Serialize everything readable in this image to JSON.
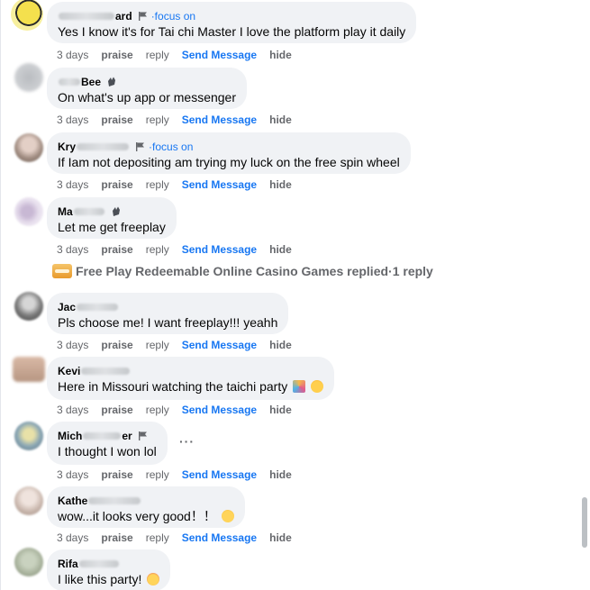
{
  "comments": [
    {
      "name_prefix": "",
      "name_suffix": "ard",
      "badge": "flag-icon",
      "focus": "·focus on",
      "text": "Yes I know it's for Tai chi Master I love the platform play it daily",
      "time": "3 days",
      "praise": "praise",
      "reply": "reply",
      "send": "Send Message",
      "hide": "hide"
    },
    {
      "name_prefix": "",
      "name_suffix": "Bee",
      "badge": "clap-icon",
      "focus": "",
      "text": "On what's up app or messenger",
      "time": "3 days",
      "praise": "praise",
      "reply": "reply",
      "send": "Send Message",
      "hide": "hide"
    },
    {
      "name_prefix": "Kry",
      "name_suffix": "",
      "badge": "flag-icon",
      "focus": "·focus on",
      "text": "If Iam not depositing am trying my luck on the free spin wheel",
      "time": "3 days",
      "praise": "praise",
      "reply": "reply",
      "send": "Send Message",
      "hide": "hide"
    },
    {
      "name_prefix": "Ma",
      "name_suffix": "",
      "badge": "clap-icon",
      "focus": "",
      "text": "Let me get freeplay",
      "time": "3 days",
      "praise": "praise",
      "reply": "reply",
      "send": "Send Message",
      "hide": "hide"
    },
    {
      "name_prefix": "Jac",
      "name_suffix": "",
      "badge": "",
      "focus": "",
      "text": "Pls choose me! I want freeplay!!! yeahh",
      "time": "3 days",
      "praise": "praise",
      "reply": "reply",
      "send": "Send Message",
      "hide": "hide"
    },
    {
      "name_prefix": "Kevi",
      "name_suffix": "",
      "badge": "",
      "focus": "",
      "text": "Here in Missouri watching the taichi party",
      "time": "3 days",
      "praise": "praise",
      "reply": "reply",
      "send": "Send Message",
      "hide": "hide"
    },
    {
      "name_prefix": "Mich",
      "name_suffix": "er",
      "badge": "flag-icon",
      "focus": "",
      "text": "I thought I won lol",
      "time": "3 days",
      "praise": "praise",
      "reply": "reply",
      "send": "Send Message",
      "hide": "hide"
    },
    {
      "name_prefix": "Kathe",
      "name_suffix": "",
      "badge": "",
      "focus": "",
      "text": "wow...it looks very good！！",
      "time": "3 days",
      "praise": "praise",
      "reply": "reply",
      "send": "Send Message",
      "hide": "hide"
    },
    {
      "name_prefix": "Rifa",
      "name_suffix": "",
      "badge": "",
      "focus": "",
      "text": "I like this party!",
      "time": "",
      "praise": "",
      "reply": "",
      "send": "",
      "hide": ""
    }
  ],
  "reply_summary": {
    "page_name": "Free Play Redeemable Online Casino Games replied",
    "sep": " · ",
    "count": "1 reply"
  },
  "more_options": "···",
  "colors": {
    "bubble": "#f0f2f5",
    "link": "#1877f2",
    "meta": "#65676b"
  }
}
